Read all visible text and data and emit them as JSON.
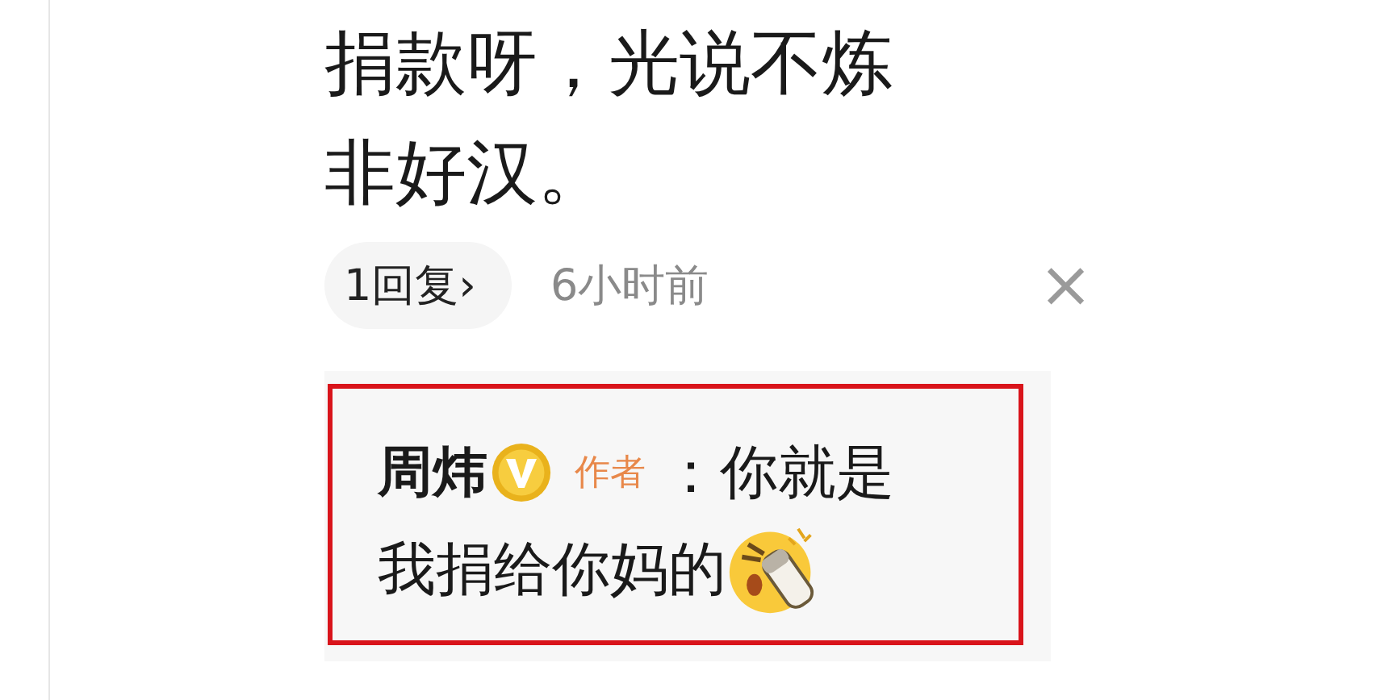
{
  "comment": {
    "text_lines": [
      "捐款呀，光说不炼",
      "非好汉。"
    ],
    "reply_count": "1回复›",
    "time": "6小时前",
    "close": "×"
  },
  "reply": {
    "highlighted": true,
    "verified": true,
    "author": "周炜",
    "badge": "作者",
    "text_lines": [
      "：你就是",
      "我捐给你妈的"
    ],
    "emoji": true
  }
}
